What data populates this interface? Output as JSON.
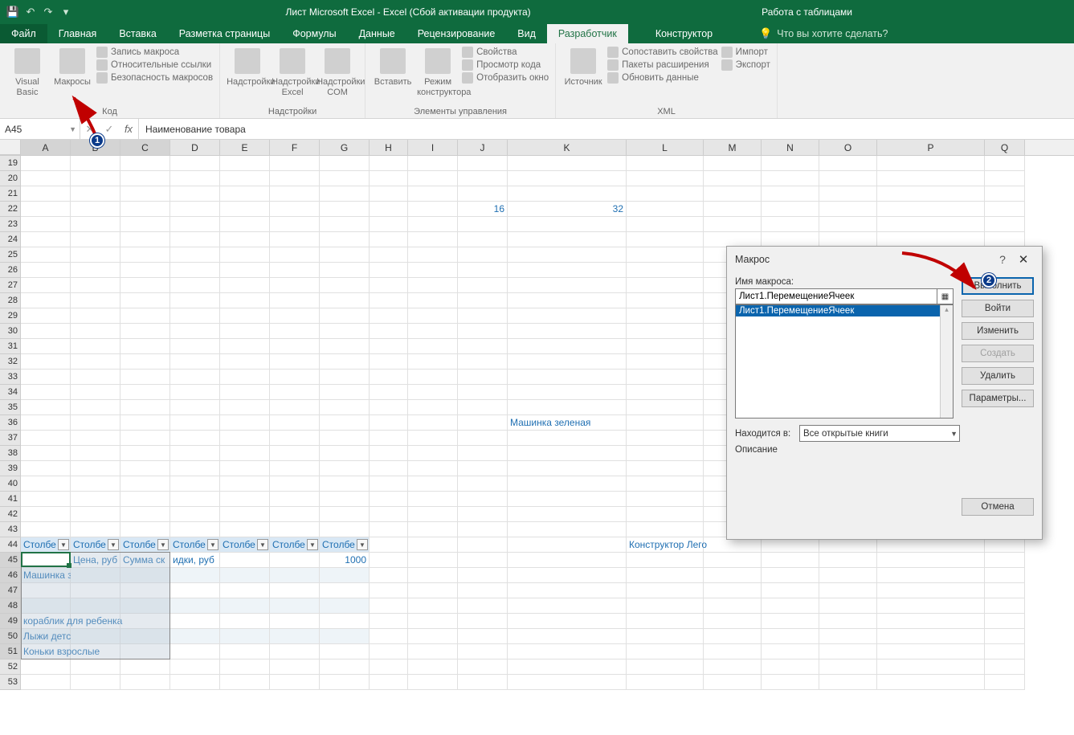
{
  "titlebar": {
    "title": "Лист Microsoft Excel - Excel (Сбой активации продукта)",
    "table_tools": "Работа с таблицами"
  },
  "tabs": {
    "file": "Файл",
    "home": "Главная",
    "insert": "Вставка",
    "pagelayout": "Разметка страницы",
    "formulas": "Формулы",
    "data": "Данные",
    "review": "Рецензирование",
    "view": "Вид",
    "developer": "Разработчик",
    "design": "Конструктор",
    "tellme": "Что вы хотите сделать?"
  },
  "ribbon": {
    "g1": {
      "vb": "Visual\nBasic",
      "macros": "Макросы",
      "rec": "Запись макроса",
      "rel": "Относительные ссылки",
      "sec": "Безопасность макросов",
      "label": "Код"
    },
    "g2": {
      "addins": "Надстройки",
      "excel": "Надстройки\nExcel",
      "com": "Надстройки\nCOM",
      "label": "Надстройки"
    },
    "g3": {
      "insert": "Вставить",
      "design": "Режим\nконструктора",
      "props": "Свойства",
      "code": "Просмотр кода",
      "dlg": "Отобразить окно",
      "label": "Элементы управления"
    },
    "g4": {
      "source": "Источник",
      "map": "Сопоставить свойства",
      "exp": "Пакеты расширения",
      "refresh": "Обновить данные",
      "import": "Импорт",
      "export": "Экспорт",
      "label": "XML"
    }
  },
  "namebox": "A45",
  "formula": "Наименование товара",
  "cols": [
    "A",
    "B",
    "C",
    "D",
    "E",
    "F",
    "G",
    "H",
    "I",
    "J",
    "K",
    "L",
    "M",
    "N",
    "O",
    "P",
    "Q"
  ],
  "rows_start": 19,
  "rows_end": 53,
  "table_headers": [
    "Столбе",
    "Столбе",
    "Столбе",
    "Столбе",
    "Столбе",
    "Столбе",
    "Столбе"
  ],
  "cells": {
    "J22": "16",
    "K22": "32",
    "K36": "Машинка зеленая",
    "L44": "Конструктор Лего",
    "A45": "Наименов",
    "B45": "Цена, руб",
    "C45": "Сумма ск",
    "D45": "идки, руб",
    "G45": "1000",
    "A46": "Машинка зеленая",
    "A49": "кораблик для ребенка",
    "A50": "Лыжи детские",
    "A51": "Коньки взрослые"
  },
  "dialog": {
    "title": "Макрос",
    "name_label": "Имя макроса:",
    "name_value": "Лист1.ПеремещениеЯчеек",
    "list_item": "Лист1.ПеремещениеЯчеек",
    "run": "Выполнить",
    "step": "Войти",
    "edit": "Изменить",
    "create": "Создать",
    "delete": "Удалить",
    "options": "Параметры...",
    "in_label": "Находится в:",
    "in_value": "Все открытые книги",
    "desc_label": "Описание",
    "cancel": "Отмена"
  },
  "callouts": {
    "one": "1",
    "two": "2"
  }
}
